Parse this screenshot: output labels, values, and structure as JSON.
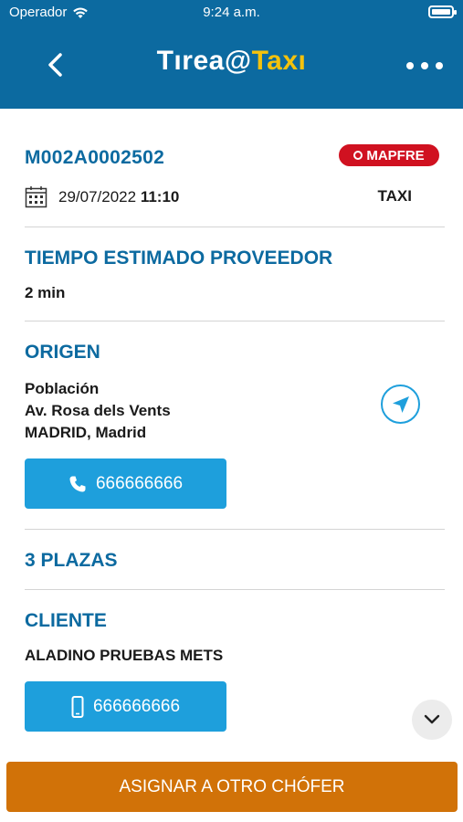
{
  "status_bar": {
    "carrier": "Operador",
    "time": "9:24 a.m.",
    "wifi_icon": "wifi-icon",
    "battery_icon": "battery-icon"
  },
  "header": {
    "back_icon": "chevron-left-icon",
    "title_part1": "Tırea@",
    "title_part2": "Taxı",
    "more_icon": "more-horizontal-icon",
    "background_color": "#0c6aa0",
    "accent_color": "#f4c20d"
  },
  "service": {
    "reference": "M002A0002502",
    "brand": "MAPFRE",
    "date": "29/07/2022",
    "hour": "11:10",
    "type": "TAXI",
    "calendar_icon": "calendar-icon"
  },
  "estimated_time": {
    "title": "TIEMPO ESTIMADO PROVEEDOR",
    "value": "2 min"
  },
  "origin": {
    "title": "ORIGEN",
    "line1": "Población",
    "line2": "Av. Rosa dels Vents",
    "line3": "MADRID, Madrid",
    "phone": "666666666",
    "phone_icon": "phone-icon",
    "navigate_icon": "navigation-arrow-icon"
  },
  "seats": {
    "title": "3 PLAZAS"
  },
  "client": {
    "title": "CLIENTE",
    "name": "ALADINO PRUEBAS METS",
    "phone": "666666666",
    "phone_icon": "mobile-phone-icon"
  },
  "scroll_icon": "chevron-down-icon",
  "footer": {
    "assign_label": "ASIGNAR A OTRO CHÓFER",
    "color": "#d17208"
  },
  "colors": {
    "primary": "#0c6aa0",
    "button": "#1e9fdc",
    "brand_red": "#d01120"
  }
}
